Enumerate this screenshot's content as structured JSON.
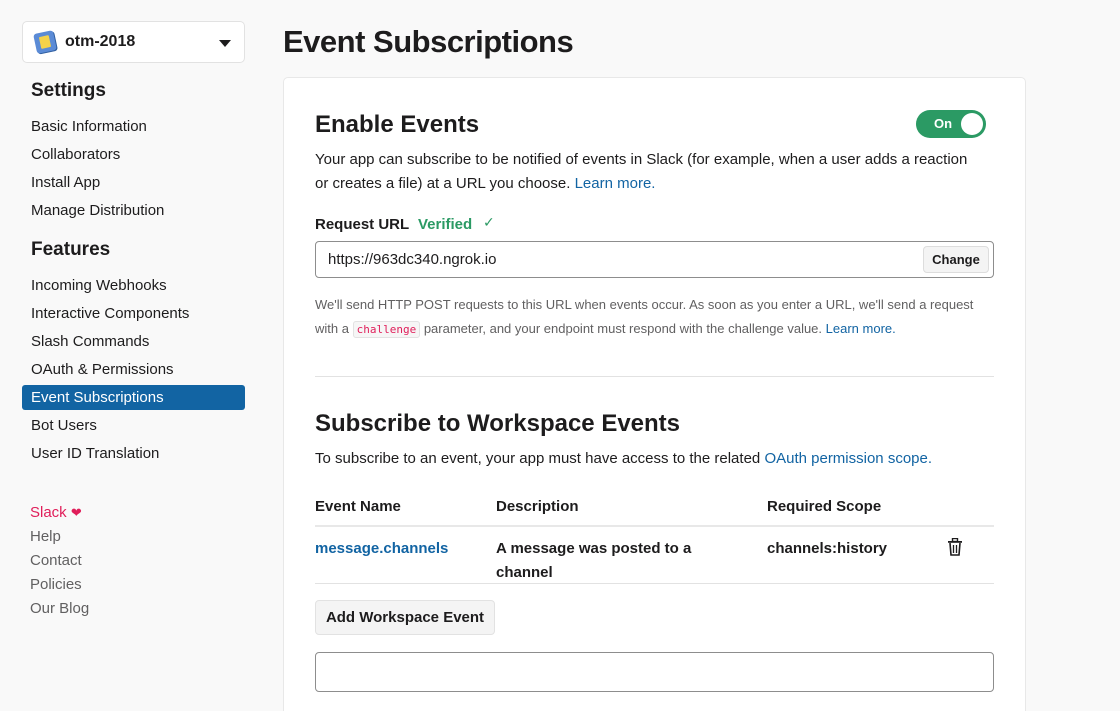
{
  "app_selector": {
    "name": "otm-2018",
    "icon": "app-icon"
  },
  "sidebar": {
    "settings_title": "Settings",
    "settings_items": [
      {
        "label": "Basic Information"
      },
      {
        "label": "Collaborators"
      },
      {
        "label": "Install App"
      },
      {
        "label": "Manage Distribution"
      }
    ],
    "features_title": "Features",
    "features_items": [
      {
        "label": "Incoming Webhooks"
      },
      {
        "label": "Interactive Components"
      },
      {
        "label": "Slash Commands"
      },
      {
        "label": "OAuth & Permissions"
      },
      {
        "label": "Event Subscriptions",
        "active": true
      },
      {
        "label": "Bot Users"
      },
      {
        "label": "User ID Translation"
      }
    ],
    "footer": {
      "slack": "Slack",
      "heart": "❤",
      "help": "Help",
      "contact": "Contact",
      "policies": "Policies",
      "blog": "Our Blog"
    }
  },
  "page": {
    "title": "Event Subscriptions"
  },
  "enable_events": {
    "title": "Enable Events",
    "toggle_label": "On",
    "description_part1": "Your app can subscribe to be notified of events in Slack (for example, when a user adds a reaction or creates a file) at a URL you choose.",
    "learn_more": "Learn more.",
    "request_url_label": "Request URL",
    "verified_label": "Verified",
    "check": "✓",
    "request_url_value": "https://963dc340.ngrok.io",
    "change_button": "Change",
    "help_part1": "We'll send HTTP POST requests to this URL when events occur. As soon as you enter a URL, we'll send a request with a",
    "help_code": "challenge",
    "help_part2": "parameter, and your endpoint must respond with the challenge value.",
    "help_learn_more": "Learn more."
  },
  "workspace_events": {
    "title": "Subscribe to Workspace Events",
    "description": "To subscribe to an event, your app must have access to the related",
    "oauth_link": "OAuth permission scope.",
    "columns": {
      "event_name": "Event Name",
      "description": "Description",
      "required_scope": "Required Scope"
    },
    "rows": [
      {
        "event_name": "message.channels",
        "description": "A message was posted to a channel",
        "required_scope": "channels:history"
      }
    ],
    "add_button": "Add Workspace Event"
  },
  "colors": {
    "accent": "#1264a3",
    "toggle_on": "#2b9a64",
    "verified": "#2b9a64",
    "slack_red": "#e01e5a"
  }
}
